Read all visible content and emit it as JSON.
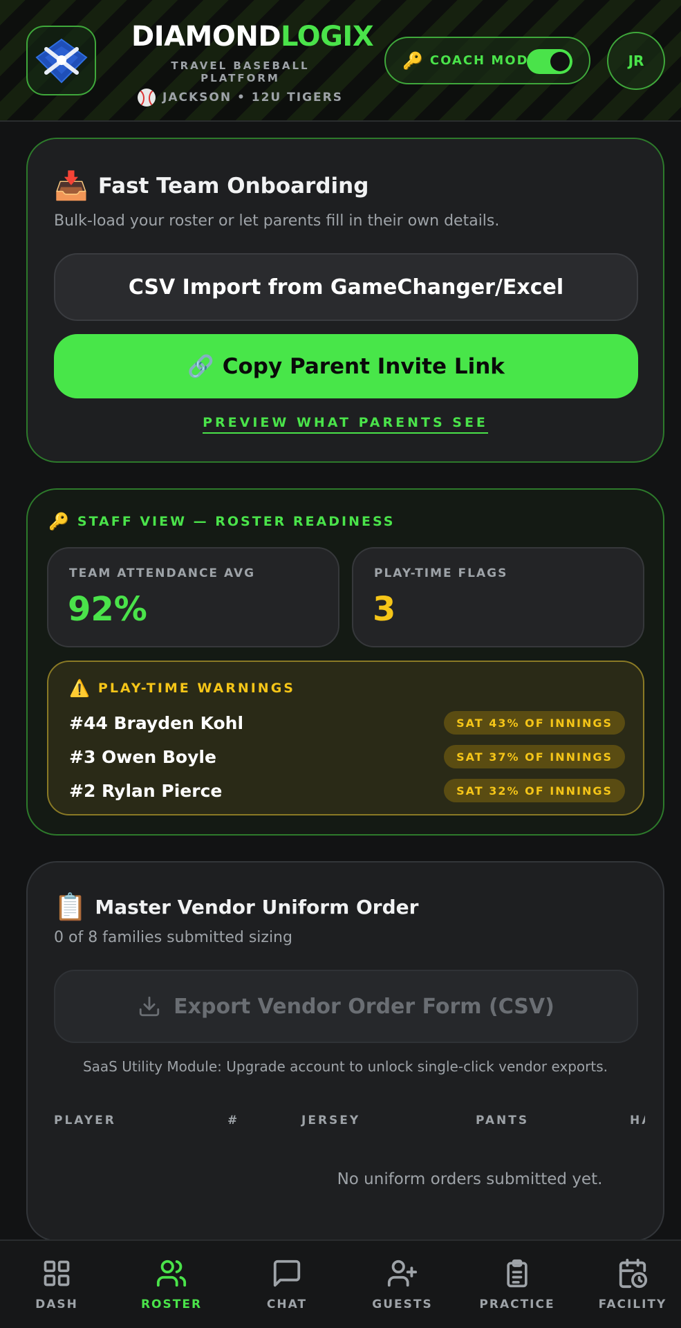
{
  "header": {
    "brand_part1": "DIAMOND",
    "brand_part2": "LOGIX",
    "subtitle": "TRAVEL BASEBALL PLATFORM",
    "team_line": "JACKSON • 12U TIGERS",
    "coach_mode_label": "COACH MODE",
    "coach_mode_on": true,
    "avatar_initials": "JR"
  },
  "onboarding": {
    "title": "Fast Team Onboarding",
    "description": "Bulk-load your roster or let parents fill in their own details.",
    "csv_button": "CSV Import from GameChanger/Excel",
    "invite_button": "Copy Parent Invite Link",
    "preview_link": "PREVIEW WHAT PARENTS SEE"
  },
  "staff": {
    "heading": "STAFF VIEW — ROSTER READINESS",
    "attendance_label": "TEAM ATTENDANCE AVG",
    "attendance_value": "92%",
    "flags_label": "PLAY-TIME FLAGS",
    "flags_value": "3",
    "warnings_heading": "PLAY-TIME WARNINGS",
    "warnings": [
      {
        "player": "#44 Brayden Kohl",
        "note": "SAT 43% OF INNINGS"
      },
      {
        "player": "#3 Owen Boyle",
        "note": "SAT 37% OF INNINGS"
      },
      {
        "player": "#2 Rylan Pierce",
        "note": "SAT 32% OF INNINGS"
      }
    ]
  },
  "uniform": {
    "title": "Master Vendor Uniform Order",
    "status": "0 of 8 families submitted sizing",
    "export_button": "Export Vendor Order Form (CSV)",
    "saas_note": "SaaS Utility Module: Upgrade account to unlock single-click vendor exports.",
    "columns": [
      "PLAYER",
      "#",
      "JERSEY",
      "PANTS",
      "HA"
    ],
    "empty_text": "No uniform orders submitted yet."
  },
  "nav": {
    "items": [
      {
        "label": "DASH",
        "icon": "grid-icon"
      },
      {
        "label": "ROSTER",
        "icon": "users-icon",
        "active": true
      },
      {
        "label": "CHAT",
        "icon": "chat-icon"
      },
      {
        "label": "GUESTS",
        "icon": "user-plus-icon"
      },
      {
        "label": "PRACTICE",
        "icon": "clipboard-icon"
      },
      {
        "label": "FACILITY",
        "icon": "calendar-clock-icon"
      }
    ]
  },
  "colors": {
    "accent": "#4ae34a",
    "warning": "#f5c518",
    "background": "#121314",
    "card": "#1e1f21"
  }
}
